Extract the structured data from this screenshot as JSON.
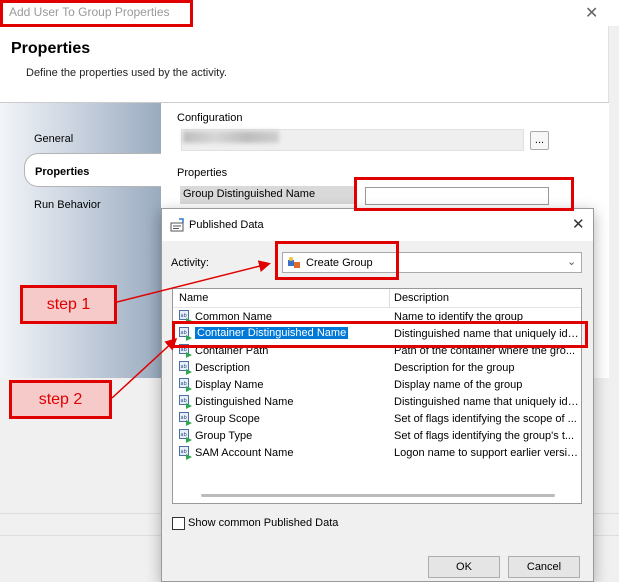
{
  "main_window": {
    "title": "Add User To Group Properties",
    "close_glyph": "✕",
    "header_title": "Properties",
    "header_subtitle": "Define the properties used by the activity."
  },
  "nav": {
    "items": [
      {
        "label": "General"
      },
      {
        "label": "Properties"
      },
      {
        "label": "Run Behavior"
      }
    ],
    "active": "Properties"
  },
  "content": {
    "configuration_label": "Configuration",
    "config_button": "...",
    "properties_label": "Properties",
    "property_name": "Group Distinguished Name",
    "property_value": ""
  },
  "dialog": {
    "title": "Published Data",
    "close_glyph": "✕",
    "activity_label": "Activity:",
    "activity_value": "Create Group",
    "columns": {
      "name": "Name",
      "description": "Description"
    },
    "rows": [
      {
        "name": "Common Name",
        "description": "Name to identify the group"
      },
      {
        "name": "Container Distinguished Name",
        "description": "Distinguished name that uniquely ide..."
      },
      {
        "name": "Container Path",
        "description": "Path of the container where the gro..."
      },
      {
        "name": "Description",
        "description": "Description for the group"
      },
      {
        "name": "Display Name",
        "description": "Display name of the group"
      },
      {
        "name": "Distinguished Name",
        "description": "Distinguished name that uniquely ide..."
      },
      {
        "name": "Group Scope",
        "description": "Set of flags identifying the scope of ..."
      },
      {
        "name": "Group Type",
        "description": "Set of flags identifying the group's t..."
      },
      {
        "name": "SAM Account Name",
        "description": "Logon name to support earlier versio..."
      }
    ],
    "selected_row": "Container Distinguished Name",
    "show_common_label": "Show common Published Data",
    "show_common_checked": false,
    "ok_label": "OK",
    "cancel_label": "Cancel"
  },
  "annotations": {
    "step1": "step 1",
    "step2": "step 2",
    "color": "#e00000"
  },
  "colors": {
    "selection": "#0078d7",
    "annotation_red": "#e00000"
  }
}
